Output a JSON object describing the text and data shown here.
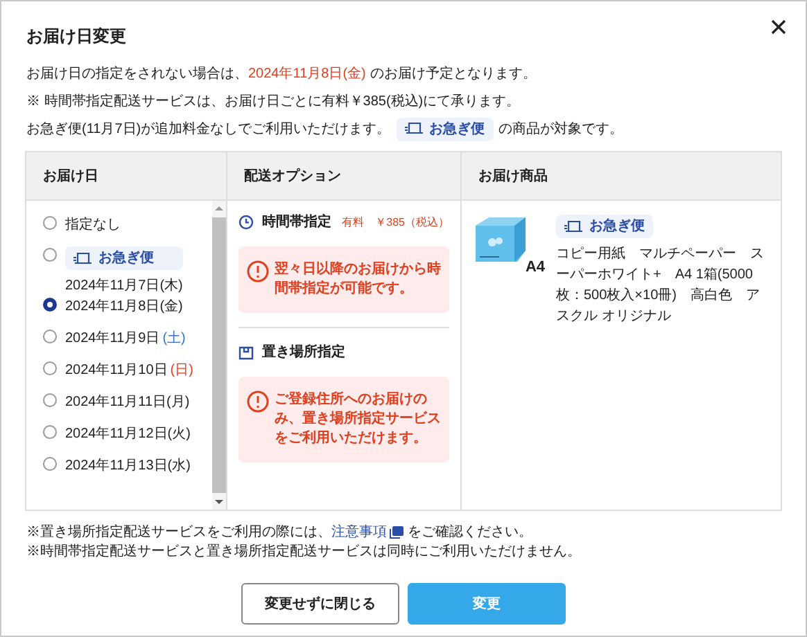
{
  "dialog": {
    "title": "お届け日変更"
  },
  "intro": [
    [
      {
        "kind": "plain",
        "text": "お届け日の指定をされない場合は、"
      },
      {
        "kind": "red",
        "text": "2024年11月8日(金)"
      },
      {
        "kind": "plain",
        "text": "のお届け予定となります。"
      }
    ],
    [
      {
        "kind": "plain",
        "text": "※ 時間帯指定配送サービスは、お届け日ごとに有料￥385(税込)にて承ります。"
      }
    ],
    [
      {
        "kind": "plain",
        "text": "お急ぎ便(11月7日)が追加料金なしでご利用いただけます。"
      },
      {
        "kind": "badge",
        "text": "お急ぎ便"
      },
      {
        "kind": "plain",
        "text": "の商品が対象です。"
      }
    ]
  ],
  "columns": [
    "お届け日",
    "配送オプション",
    "お届け商品"
  ],
  "dates": [
    {
      "kind": "plain",
      "label": "指定なし",
      "selected": false
    },
    {
      "kind": "express",
      "badge": "お急ぎ便",
      "label": "2024年11月7日(木)",
      "selected": false
    },
    {
      "kind": "plain",
      "label": "2024年11月8日(金)",
      "selected": true
    },
    {
      "kind": "plain",
      "label": "2024年11月9日",
      "day": "(土)",
      "color": "#3b6fd0",
      "selected": false
    },
    {
      "kind": "plain",
      "label": "2024年11月10日",
      "day": "(日)",
      "color": "#e0401f",
      "selected": false
    },
    {
      "kind": "plain",
      "label": "2024年11月11日(月)",
      "selected": false
    },
    {
      "kind": "plain",
      "label": "2024年11月12日(火)",
      "selected": false
    },
    {
      "kind": "plain",
      "label": "2024年11月13日(水)",
      "selected": false
    }
  ],
  "options": [
    {
      "kind": "time",
      "title": "時間帯指定",
      "price": "有料　￥385（税込）",
      "notice": "翌々日以降のお届けから時間帯指定が可能です。"
    },
    {
      "kind": "place",
      "title": "置き場所指定",
      "notice": "ご登録住所へのお届けのみ、置き場所指定サービスをご利用いただけます。"
    }
  ],
  "product": {
    "badge": "お急ぎ便",
    "name": "コピー用紙　マルチペーパー　スーパーホワイト+　A4 1箱(5000枚：500枚入×10冊)　高白色　アスクル オリジナル",
    "size_label": "A4"
  },
  "notes": [
    {
      "before": "※置き場所指定配送サービスをご利用の際には、",
      "link": "注意事項",
      "after": "をご確認ください。"
    },
    {
      "before": "※時間帯指定配送サービスと置き場所指定配送サービスは同時にご利用いただけません。"
    }
  ],
  "buttons": [
    {
      "kind": "secondary",
      "label": "変更せずに閉じる"
    },
    {
      "kind": "primary",
      "label": "変更"
    }
  ]
}
